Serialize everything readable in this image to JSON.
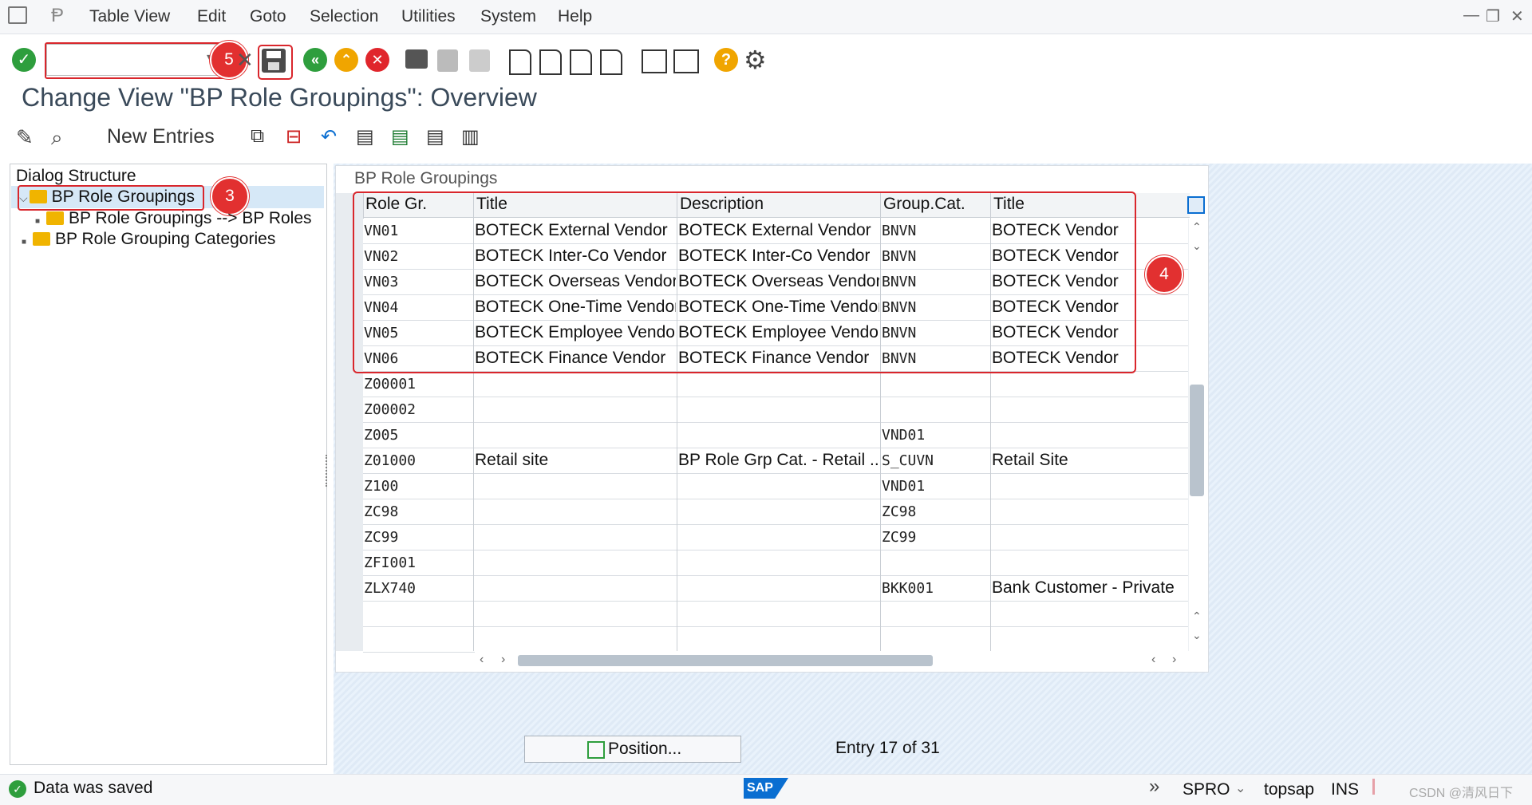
{
  "menu": {
    "items": [
      "Table View",
      "Edit",
      "Goto",
      "Selection",
      "Utilities",
      "System",
      "Help"
    ]
  },
  "toolbar": {
    "command_field": {
      "value": "",
      "placeholder": ""
    }
  },
  "page_title": "Change View \"BP Role Groupings\": Overview",
  "app_toolbar": {
    "new_entries": "New Entries"
  },
  "dialog_structure": {
    "heading": "Dialog Structure",
    "items": [
      {
        "label": "BP Role Groupings"
      },
      {
        "label": "BP Role Groupings --> BP Roles"
      },
      {
        "label": "BP Role Grouping Categories"
      }
    ]
  },
  "grid": {
    "title": "BP Role Groupings",
    "columns": [
      "Role Gr.",
      "Title",
      "Description",
      "Group.Cat.",
      "Title"
    ],
    "rows": [
      [
        "VN01",
        "BOTECK External Vendor",
        "BOTECK External Vendor",
        "BNVN",
        "BOTECK Vendor"
      ],
      [
        "VN02",
        "BOTECK Inter-Co Vendor",
        "BOTECK Inter-Co Vendor",
        "BNVN",
        "BOTECK Vendor"
      ],
      [
        "VN03",
        "BOTECK Overseas Vendor",
        "BOTECK Overseas Vendor",
        "BNVN",
        "BOTECK Vendor"
      ],
      [
        "VN04",
        "BOTECK One-Time Vendor",
        "BOTECK One-Time Vendor",
        "BNVN",
        "BOTECK Vendor"
      ],
      [
        "VN05",
        "BOTECK Employee Vendor",
        "BOTECK Employee Vendor",
        "BNVN",
        "BOTECK Vendor"
      ],
      [
        "VN06",
        "BOTECK Finance Vendor",
        "BOTECK Finance Vendor",
        "BNVN",
        "BOTECK Vendor"
      ],
      [
        "Z00001",
        "",
        "",
        "",
        ""
      ],
      [
        "Z00002",
        "",
        "",
        "",
        ""
      ],
      [
        "Z005",
        "",
        "",
        "VND01",
        ""
      ],
      [
        "Z01000",
        "Retail site",
        "BP Role Grp Cat. - Retail ...",
        "S_CUVN",
        "Retail Site"
      ],
      [
        "Z100",
        "",
        "",
        "VND01",
        ""
      ],
      [
        "ZC98",
        "",
        "",
        "ZC98",
        ""
      ],
      [
        "ZC99",
        "",
        "",
        "ZC99",
        ""
      ],
      [
        "ZFI001",
        "",
        "",
        "",
        ""
      ],
      [
        "ZLX740",
        "",
        "",
        "BKK001",
        "Bank Customer - Private"
      ]
    ]
  },
  "annotations": {
    "badge_3": "3",
    "badge_4": "4",
    "badge_5": "5"
  },
  "position_button": "Position...",
  "entry_status": "Entry 17 of 31",
  "status": {
    "message": "Data was saved",
    "transaction": "SPRO",
    "server": "topsap",
    "mode": "INS",
    "watermark": "CSDN @清风日下"
  },
  "colors": {
    "accent": "#0a6ed1",
    "annotation_red": "#e23030",
    "selected_row": "#d6e8f7"
  }
}
